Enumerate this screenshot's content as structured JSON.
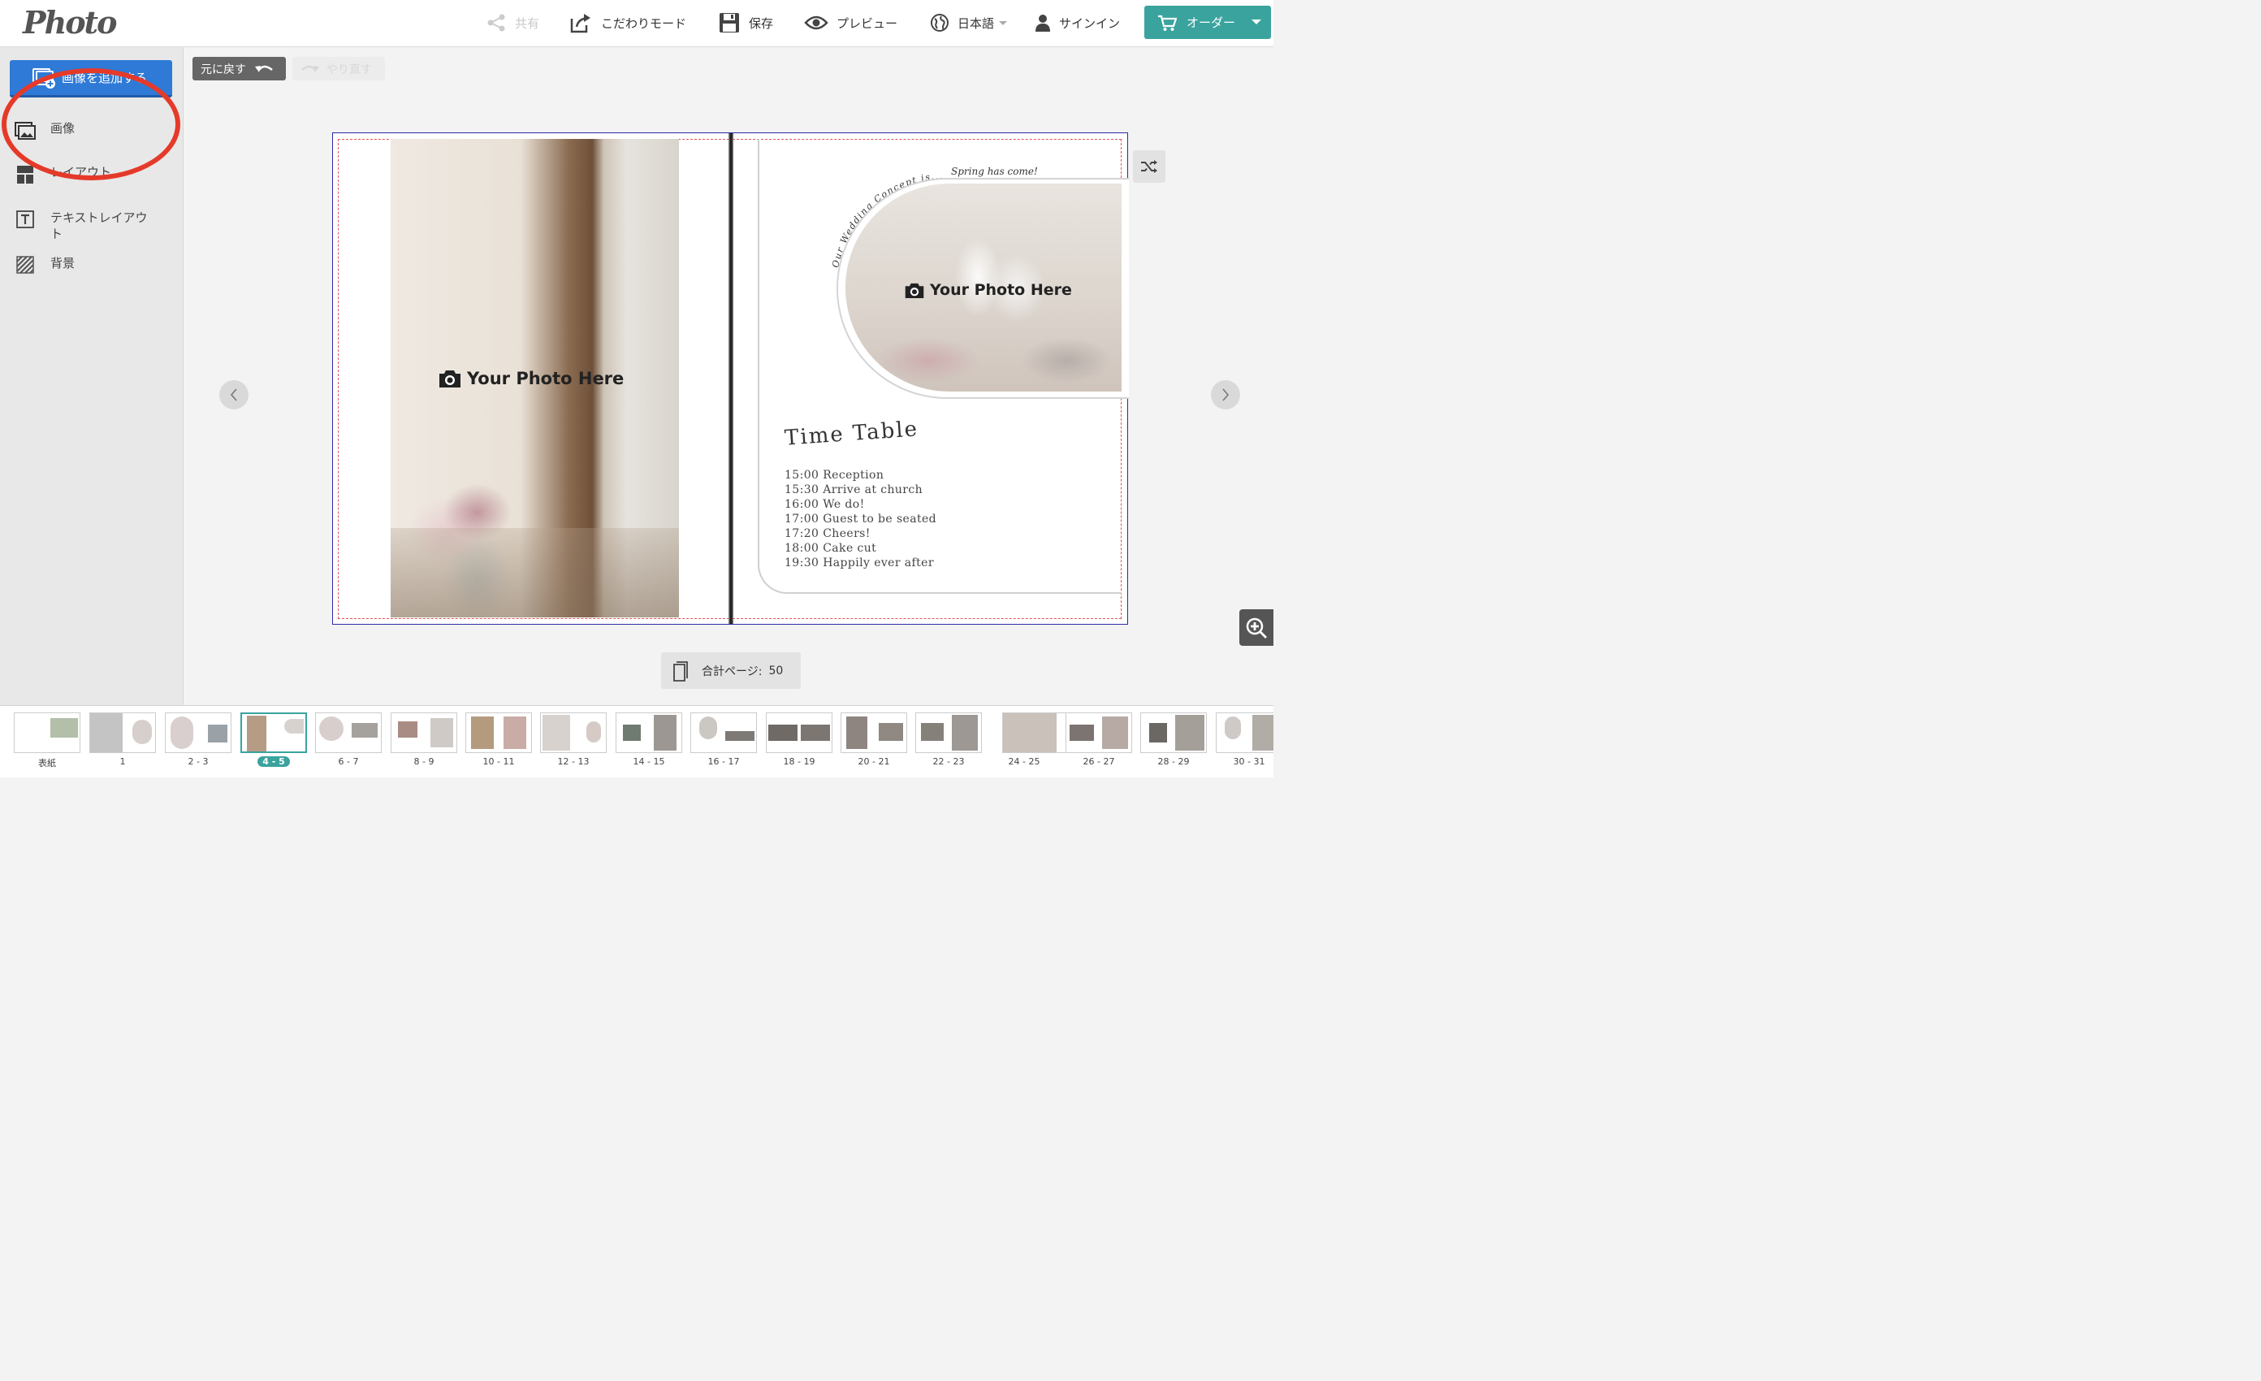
{
  "header": {
    "logo_text": "Photo",
    "logo_sub": "Photo",
    "share": "共有",
    "custom_mode": "こだわりモード",
    "save": "保存",
    "preview": "プレビュー",
    "language": "日本語",
    "signin": "サインイン",
    "order": "オーダー"
  },
  "sidebar": {
    "add_image": "画像を追加する",
    "items": [
      {
        "label": "画像",
        "icon": "image-icon"
      },
      {
        "label": "レイアウト",
        "icon": "layout-icon"
      },
      {
        "label": "テキストレイアウト",
        "icon": "text-layout-icon"
      },
      {
        "label": "背景",
        "icon": "background-icon"
      }
    ]
  },
  "toolbar": {
    "undo": "元に戻す",
    "redo": "やり直す"
  },
  "canvas": {
    "left_placeholder": "Your Photo Here",
    "right_placeholder": "Your Photo Here",
    "arc_text": "Our Wedding Concept is...",
    "spring_text": "Spring has come!",
    "timetable_title": "Time Table",
    "timetable": [
      "15:00  Reception",
      "15:30  Arrive at church",
      "16:00  We do!",
      "17:00  Guest to be seated",
      "17:20  Cheers!",
      "18:00  Cake cut",
      "19:30  Happily ever after"
    ]
  },
  "footer": {
    "total_pages_label": "合計ページ:",
    "total_pages_value": "50"
  },
  "thumbnails": [
    {
      "label": "表紙",
      "active": false
    },
    {
      "label": "1",
      "active": false
    },
    {
      "label": "2 - 3",
      "active": false
    },
    {
      "label": "4 - 5",
      "active": true
    },
    {
      "label": "6 - 7",
      "active": false
    },
    {
      "label": "8 - 9",
      "active": false
    },
    {
      "label": "10 - 11",
      "active": false
    },
    {
      "label": "12 - 13",
      "active": false
    },
    {
      "label": "14 - 15",
      "active": false
    },
    {
      "label": "16 - 17",
      "active": false
    },
    {
      "label": "18 - 19",
      "active": false
    },
    {
      "label": "20 - 21",
      "active": false
    },
    {
      "label": "22 - 23",
      "active": false
    },
    {
      "label": "24 - 25",
      "active": false
    },
    {
      "label": "26 - 27",
      "active": false
    },
    {
      "label": "28 - 29",
      "active": false
    },
    {
      "label": "30 - 31",
      "active": false
    }
  ],
  "colors": {
    "primary_blue": "#2f7ad6",
    "teal": "#3aa39e",
    "annotation_red": "#e53a2a",
    "bleed_guide": "#e05555",
    "spread_border": "#2a2aa8"
  }
}
